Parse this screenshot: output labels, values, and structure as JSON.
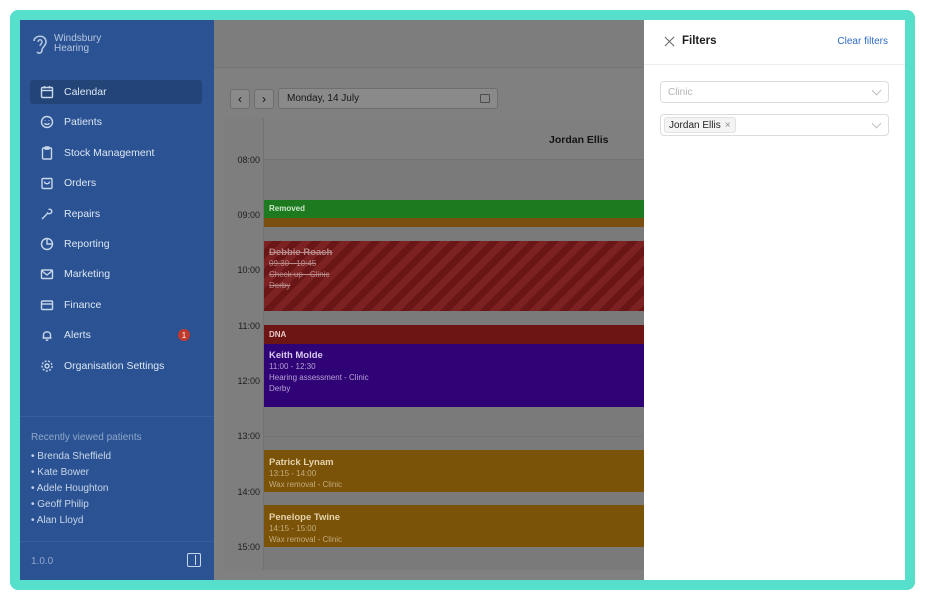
{
  "brand": {
    "line1": "Windsbury",
    "line2": "Hearing"
  },
  "sidebar": {
    "items": [
      {
        "label": "Calendar",
        "icon": "calendar-icon"
      },
      {
        "label": "Patients",
        "icon": "smile-icon"
      },
      {
        "label": "Stock Management",
        "icon": "clipboard-icon"
      },
      {
        "label": "Orders",
        "icon": "bag-icon"
      },
      {
        "label": "Repairs",
        "icon": "wrench-icon"
      },
      {
        "label": "Reporting",
        "icon": "pie-chart-icon"
      },
      {
        "label": "Marketing",
        "icon": "mail-icon"
      },
      {
        "label": "Finance",
        "icon": "card-icon"
      },
      {
        "label": "Alerts",
        "icon": "bell-icon",
        "badge": "1"
      },
      {
        "label": "Organisation Settings",
        "icon": "gear-icon"
      }
    ],
    "recent_title": "Recently viewed patients",
    "recent": [
      "• Brenda Sheffield",
      "• Kate Bower",
      "• Adele Houghton",
      "• Geoff Philip",
      "• Alan Lloyd"
    ],
    "version": "1.0.0"
  },
  "toolbar": {
    "prev": "‹",
    "next": "›",
    "date": "Monday, 14 July"
  },
  "calendar": {
    "resource": "Jordan Ellis",
    "times": [
      "08:00",
      "09:00",
      "10:00",
      "11:00",
      "12:00",
      "13:00",
      "14:00",
      "15:00"
    ],
    "events": {
      "removed": {
        "label": "Removed"
      },
      "debbie": {
        "name": "Debbie Roach",
        "time": "09:30 - 10:45",
        "type": "Check up - Clinic",
        "location": "Derby"
      },
      "dna": {
        "label": "DNA"
      },
      "keith": {
        "name": "Keith Molde",
        "time": "11:00 - 12:30",
        "type": "Hearing assessment - Clinic",
        "location": "Derby"
      },
      "patrick": {
        "name": "Patrick Lynam",
        "time": "13:15 - 14:00",
        "type": "Wax removal - Clinic"
      },
      "penelope": {
        "name": "Penelope Twine",
        "time": "14:15 - 15:00",
        "type": "Wax removal - Clinic"
      }
    }
  },
  "filters": {
    "title": "Filters",
    "clear": "Clear filters",
    "clinic_placeholder": "Clinic",
    "clinician_tag": "Jordan Ellis",
    "tag_remove": "×"
  },
  "colors": {
    "sidebar": "#2b5393",
    "accent": "#2e6bc6",
    "frame": "#56e0cc"
  }
}
